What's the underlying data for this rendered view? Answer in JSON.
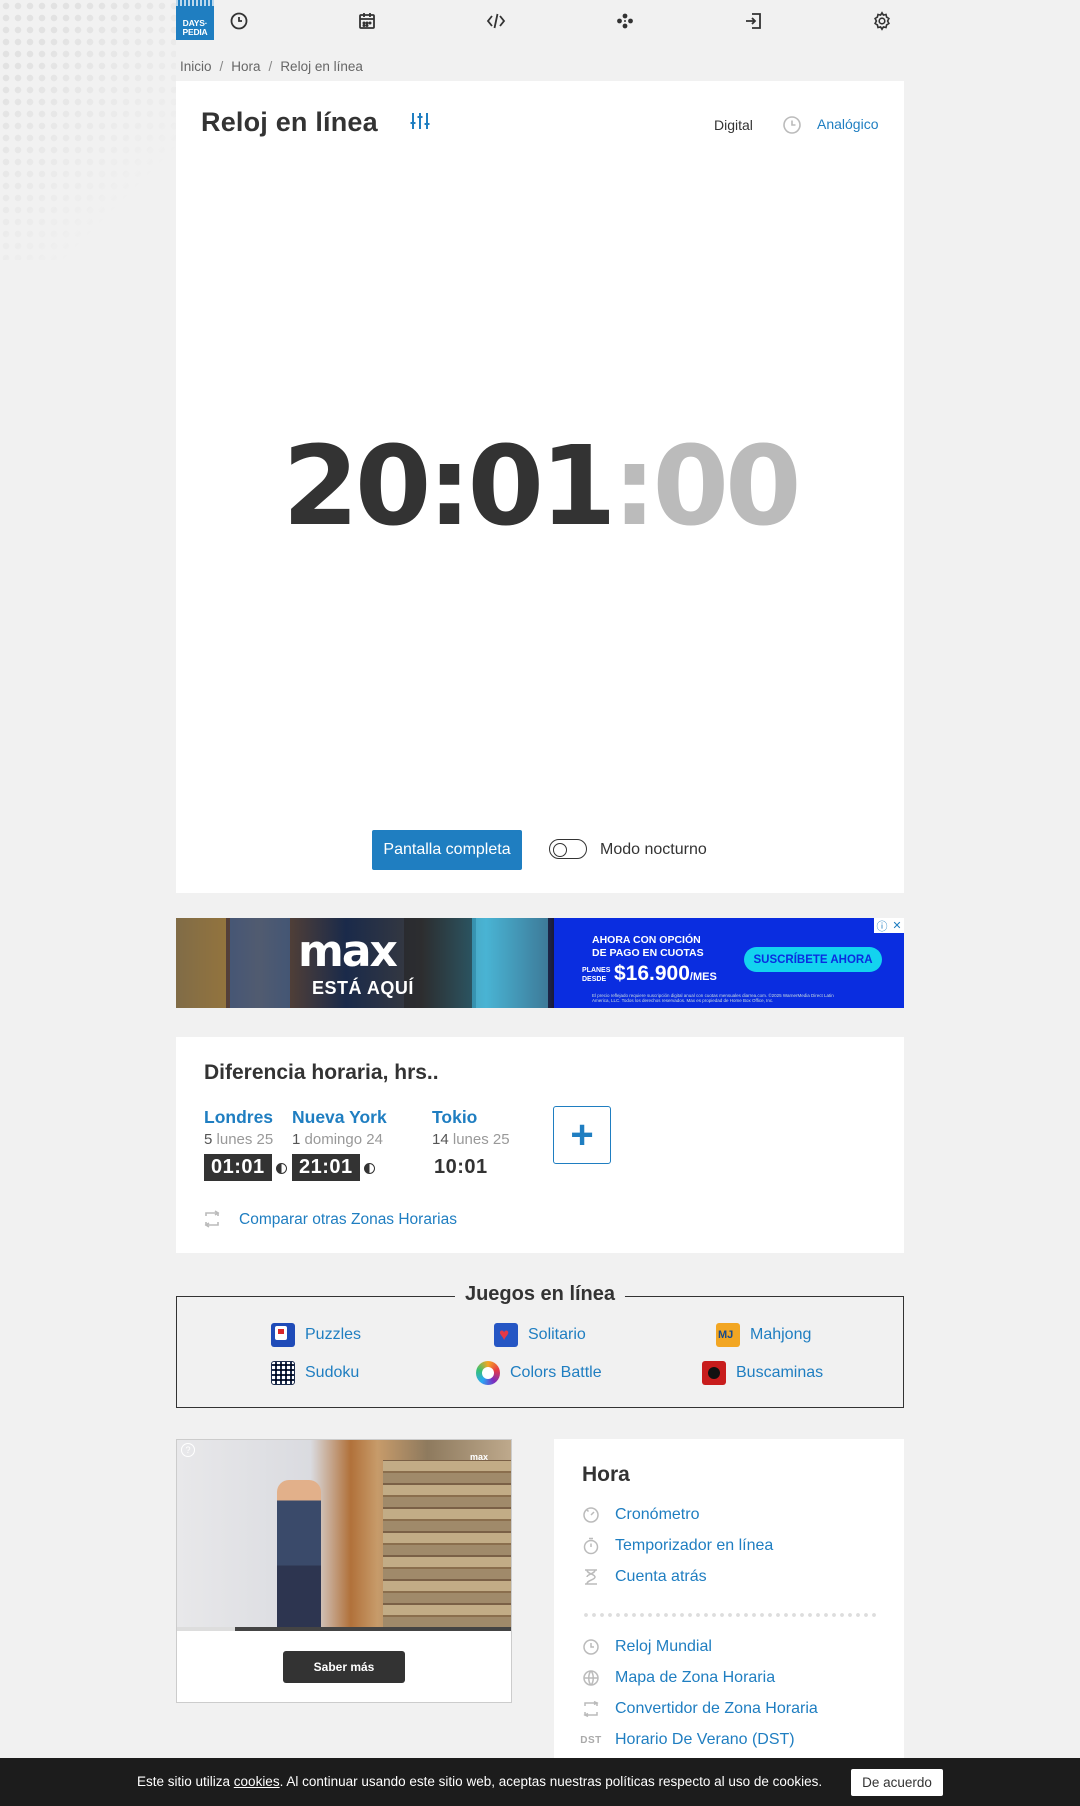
{
  "brand": {
    "line1": "DAYS·",
    "line2": "PEDIA"
  },
  "breadcrumb": [
    "Inicio",
    "Hora",
    "Reloj en línea"
  ],
  "clock": {
    "title": "Reloj en línea",
    "mode_digital": "Digital",
    "mode_analog": "Analógico",
    "time_hm": "20:01",
    "time_sec": ":00",
    "fullscreen_label": "Pantalla completa",
    "night_mode_label": "Modo nocturno"
  },
  "ad": {
    "brand": "max",
    "tagline": "ESTÁ AQUÍ",
    "headline_1": "AHORA CON OPCIÓN",
    "headline_2": "DE PAGO EN CUOTAS",
    "price_label_1": "PLANES",
    "price_label_2": "DESDE",
    "price": "$16.900",
    "price_unit": "/MES",
    "cta": "SUSCRÍBETE AHORA",
    "fine_print": "El precio reflejado requiere suscripción digital anual con cuotas mensuales diarrea.com. ©2025 WarnerMedia Direct Latin America, LLC. Todos los derechos reservados. Max es propiedad de Home Box Office, Inc."
  },
  "time_diff": {
    "title": "Diferencia horaria, hrs..",
    "cities": [
      {
        "name": "Londres",
        "offset": "5",
        "day": "lunes 25",
        "time": "01:01",
        "night": true
      },
      {
        "name": "Nueva York",
        "offset": "1",
        "day": "domingo 24",
        "time": "21:01",
        "night": true
      },
      {
        "name": "Tokio",
        "offset": "14",
        "day": "lunes 25",
        "time": "10:01",
        "night": false
      }
    ],
    "add_label": "+",
    "compare_label": "Comparar otras Zonas Horarias"
  },
  "games": {
    "title": "Juegos en línea",
    "items": [
      "Puzzles",
      "Solitario",
      "Mahjong",
      "Sudoku",
      "Colors Battle",
      "Buscaminas"
    ]
  },
  "video": {
    "cta": "Saber más",
    "logo": "max",
    "badge": "?"
  },
  "side": {
    "title": "Hora",
    "group1": [
      "Cronómetro",
      "Temporizador en línea",
      "Cuenta atrás"
    ],
    "group2": [
      "Reloj Mundial",
      "Mapa de Zona Horaria",
      "Convertidor de Zona Horaria",
      "Horario De Verano (DST)"
    ],
    "dst_icon_text": "DST"
  },
  "cookie": {
    "text_before": "Este sitio utiliza ",
    "link": "cookies",
    "text_after": ". Al continuar usando este sitio web, aceptas nuestras políticas respecto al uso de cookies.",
    "accept": "De acuerdo"
  },
  "colors": {
    "accent": "#1f7ec1",
    "dark": "#333333",
    "background": "#f1f1f1",
    "ad_blue": "#0a2de0",
    "ad_cyan": "#13d3ef"
  }
}
